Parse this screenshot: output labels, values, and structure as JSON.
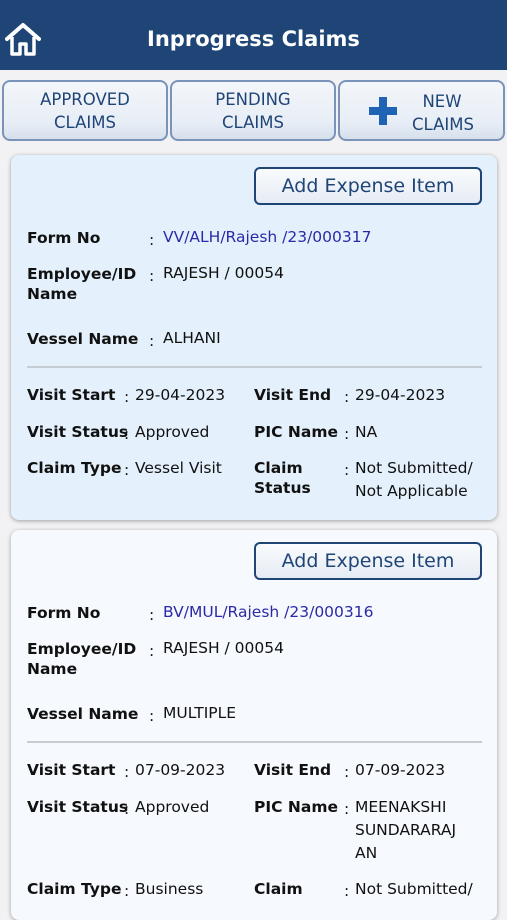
{
  "header": {
    "title": "Inprogress Claims",
    "home_icon": "home-icon"
  },
  "tabs": {
    "approved": {
      "line1": "APPROVED",
      "line2": "CLAIMS"
    },
    "pending": {
      "line1": "PENDING",
      "line2": "CLAIMS"
    },
    "new": {
      "line1": "NEW",
      "line2": "CLAIMS",
      "icon": "plus-icon",
      "icon_color": "#1f63b4"
    }
  },
  "labels": {
    "add_expense": "Add Expense Item",
    "form_no": "Form No",
    "employee_id_1": "Employee/ID",
    "employee_id_2": "Name",
    "vessel_name": "Vessel Name",
    "visit_start": "Visit Start",
    "visit_end": "Visit End",
    "visit_status": "Visit Status",
    "pic_name": "PIC Name",
    "claim_type": "Claim Type",
    "claim_status_1": "Claim",
    "claim_status_2": "Status",
    "colon": ":"
  },
  "claims": [
    {
      "form_no": "VV/ALH/Rajesh  /23/000317",
      "employee": "RAJESH   / 00054",
      "vessel_name": "ALHANI",
      "visit_start": "29-04-2023",
      "visit_end": "29-04-2023",
      "visit_status": "Approved",
      "pic_name": "NA",
      "claim_type": "Vessel Visit",
      "claim_status_1": "Not Submitted/",
      "claim_status_2": "Not Applicable"
    },
    {
      "form_no": "BV/MUL/Rajesh  /23/000316",
      "employee": "RAJESH   / 00054",
      "vessel_name": "MULTIPLE",
      "visit_start": "07-09-2023",
      "visit_end": "07-09-2023",
      "visit_status": "Approved",
      "pic_name_1": "MEENAKSHI",
      "pic_name_2": "SUNDARARAJ",
      "pic_name_3": "AN",
      "claim_type": "Business",
      "claim_status_1": "Not Submitted/"
    }
  ],
  "colors": {
    "header_bg": "#1f4577",
    "link": "#2a2aa8",
    "card_active_bg": "#e4f1fc"
  }
}
